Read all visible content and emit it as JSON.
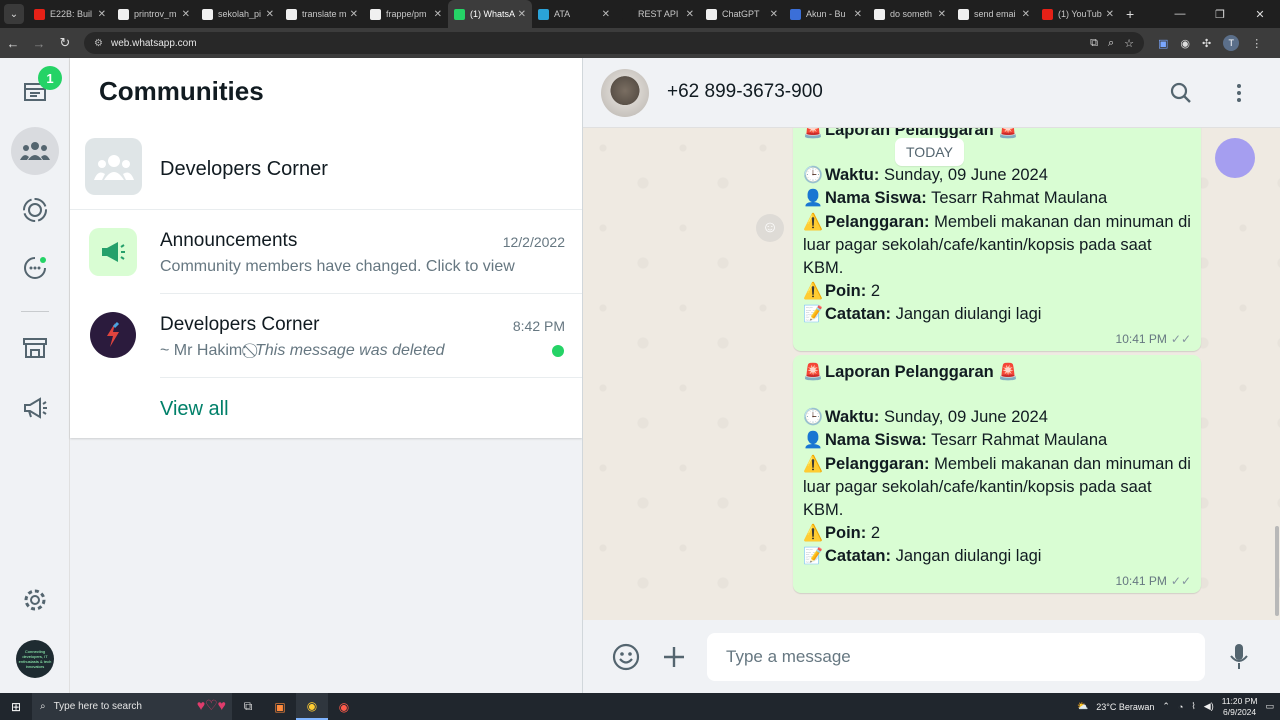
{
  "browser": {
    "tabs": [
      {
        "title": "E22B: Buil",
        "icon": "youtube-icon",
        "color": "#e62117",
        "active": false
      },
      {
        "title": "printrov_m",
        "icon": "github-icon",
        "color": "#f0f0f0",
        "active": false
      },
      {
        "title": "sekolah_pi",
        "icon": "github-icon",
        "color": "#f0f0f0",
        "active": false
      },
      {
        "title": "translate m",
        "icon": "google-icon",
        "color": "#f0f0f0",
        "active": false
      },
      {
        "title": "frappe/pm",
        "icon": "github-icon",
        "color": "#f0f0f0",
        "active": false
      },
      {
        "title": "(1) WhatsA",
        "icon": "whatsapp-icon",
        "color": "#25d366",
        "active": true
      },
      {
        "title": "ATA",
        "icon": "telegram-icon",
        "color": "#2aa3d9",
        "active": false
      },
      {
        "title": "REST API",
        "icon": "blank-icon",
        "color": "#1f1f1f",
        "active": false
      },
      {
        "title": "ChatGPT",
        "icon": "chatgpt-icon",
        "color": "#f0f0f0",
        "active": false
      },
      {
        "title": "Akun - Bu",
        "icon": "cube-icon",
        "color": "#3b6fd8",
        "active": false
      },
      {
        "title": "do someth",
        "icon": "google-icon",
        "color": "#f0f0f0",
        "active": false
      },
      {
        "title": "send emai",
        "icon": "google-icon",
        "color": "#f0f0f0",
        "active": false
      },
      {
        "title": "(1) YouTub",
        "icon": "youtube-icon",
        "color": "#e62117",
        "active": false
      }
    ],
    "url": "web.whatsapp.com",
    "profile_initial": "T"
  },
  "rail": {
    "chats_badge": "1",
    "avatar_text": "Connecting developers, IT enthusiasts & tech innovators"
  },
  "communities": {
    "title": "Communities",
    "community_name": "Developers Corner",
    "rows": [
      {
        "name": "Announcements",
        "time": "12/2/2022",
        "sub": "Community members have changed. Click to view"
      },
      {
        "name": "Developers Corner",
        "time": "8:42 PM",
        "sub_sender": "~ Mr Hakim:",
        "sub": "This message was deleted"
      }
    ],
    "view_all": "View all"
  },
  "chat": {
    "contact": "+62 899-3673-900",
    "date_divider": "TODAY",
    "messages": [
      {
        "title": "Laporan Pelanggaran",
        "waktu_label": "Waktu:",
        "waktu": "Sunday, 09 June 2024",
        "nama_label": "Nama Siswa:",
        "nama": "Tesarr Rahmat Maulana",
        "pelanggaran_label": "Pelanggaran:",
        "pelanggaran": "Membeli makanan dan minuman di luar pagar sekolah/cafe/kantin/kopsis pada saat KBM.",
        "poin_label": "Poin:",
        "poin": "2",
        "catatan_label": "Catatan:",
        "catatan": "Jangan diulangi lagi",
        "time": "10:41 PM"
      },
      {
        "title": "Laporan Pelanggaran",
        "waktu_label": "Waktu:",
        "waktu": "Sunday, 09 June 2024",
        "nama_label": "Nama Siswa:",
        "nama": "Tesarr Rahmat Maulana",
        "pelanggaran_label": "Pelanggaran:",
        "pelanggaran": "Membeli makanan dan minuman di luar pagar sekolah/cafe/kantin/kopsis pada saat KBM.",
        "poin_label": "Poin:",
        "poin": "2",
        "catatan_label": "Catatan:",
        "catatan": "Jangan diulangi lagi",
        "time": "10:41 PM"
      }
    ],
    "input_placeholder": "Type a message"
  },
  "taskbar": {
    "search_placeholder": "Type here to search",
    "weather": "23°C  Berawan",
    "time": "11:20 PM",
    "date": "6/9/2024"
  },
  "colors": {
    "accent": "#008069",
    "online_dot": "#25d366",
    "bubble_out": "#d9fdd3"
  }
}
